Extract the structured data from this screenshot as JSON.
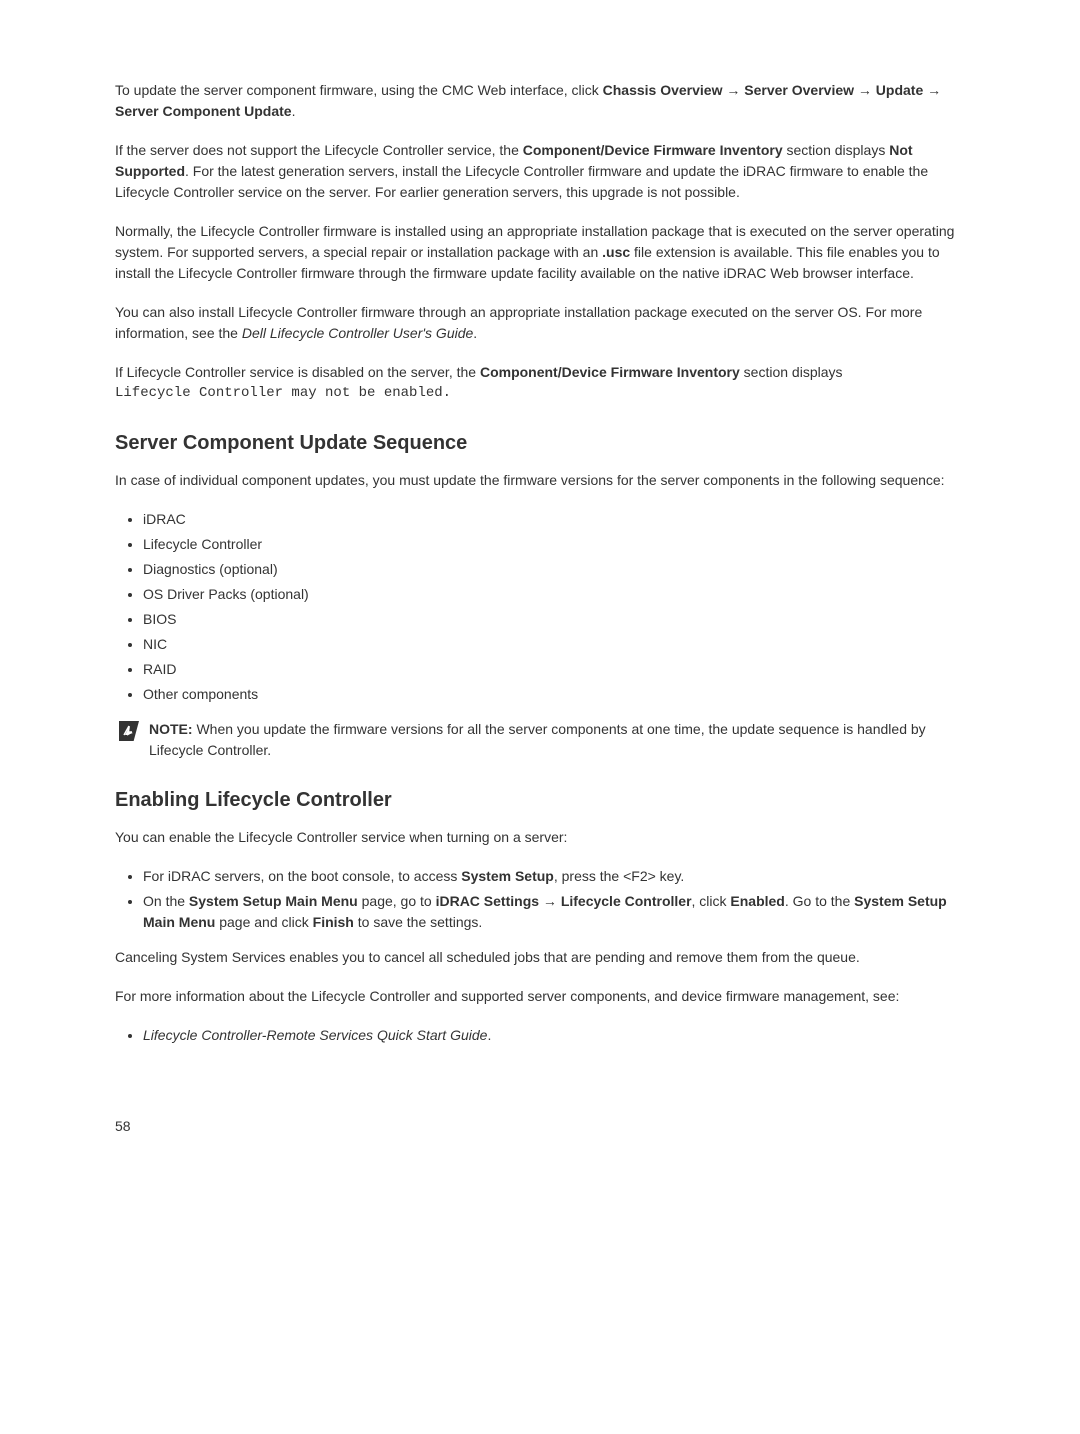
{
  "p1_a": "To update the server component firmware, using the CMC Web interface, click ",
  "p1_b": "Chassis Overview",
  "p1_c": " → ",
  "p1_d": "Server Overview",
  "p1_e": " → ",
  "p1_f": "Update",
  "p1_g": " → ",
  "p1_h": "Server Component Update",
  "p1_i": ".",
  "p2_a": "If the server does not support the Lifecycle Controller service, the ",
  "p2_b": "Component/Device Firmware Inventory",
  "p2_c": " section displays ",
  "p2_d": "Not Supported",
  "p2_e": ". For the latest generation servers, install the Lifecycle Controller firmware and update the iDRAC firmware to enable the Lifecycle Controller service on the server. For earlier generation servers, this upgrade is not possible.",
  "p3_a": "Normally, the Lifecycle Controller firmware is installed using an appropriate installation package that is executed on the server operating system. For supported servers, a special repair or installation package with an ",
  "p3_b": ".usc",
  "p3_c": " file extension is available. This file enables you to install the Lifecycle Controller firmware through the firmware update facility available on the native iDRAC Web browser interface.",
  "p4_a": "You can also install Lifecycle Controller firmware through an appropriate installation package executed on the server OS. For more information, see the ",
  "p4_b": "Dell Lifecycle Controller User's Guide",
  "p4_c": ".",
  "p5_a": "If Lifecycle Controller service is disabled on the server, the ",
  "p5_b": "Component/Device Firmware Inventory",
  "p5_c": " section displays",
  "p5_d": "Lifecycle Controller may not be enabled.",
  "h1": "Server Component Update Sequence",
  "p6": "In case of individual component updates, you must update the firmware versions for the server components in the following sequence:",
  "list1": {
    "i0": "iDRAC",
    "i1": "Lifecycle Controller",
    "i2": "Diagnostics (optional)",
    "i3": "OS Driver Packs (optional)",
    "i4": "BIOS",
    "i5": "NIC",
    "i6": "RAID",
    "i7": "Other components"
  },
  "note1_a": "NOTE: ",
  "note1_b": "When you update the firmware versions for all the server components at one time, the update sequence is handled by Lifecycle Controller.",
  "h2": "Enabling Lifecycle Controller",
  "p7": "You can enable the Lifecycle Controller service when turning on a server:",
  "list2": {
    "i0_a": "For iDRAC servers, on the boot console, to access ",
    "i0_b": "System Setup",
    "i0_c": ", press the <F2> key.",
    "i1_a": "On the ",
    "i1_b": "System Setup Main Menu",
    "i1_c": " page, go to ",
    "i1_d": "iDRAC Settings",
    "i1_e": " → ",
    "i1_f": "Lifecycle Controller",
    "i1_g": ", click ",
    "i1_h": "Enabled",
    "i1_i": ". Go to the ",
    "i1_j": "System Setup Main Menu",
    "i1_k": " page and click ",
    "i1_l": "Finish",
    "i1_m": " to save the settings."
  },
  "p8": "Canceling System Services enables you to cancel all scheduled jobs that are pending and remove them from the queue.",
  "p9": "For more information about the Lifecycle Controller and supported server components, and device firmware management, see:",
  "list3": {
    "i0_a": "Lifecycle Controller-Remote Services Quick Start Guide",
    "i0_b": "."
  },
  "page_number": "58"
}
